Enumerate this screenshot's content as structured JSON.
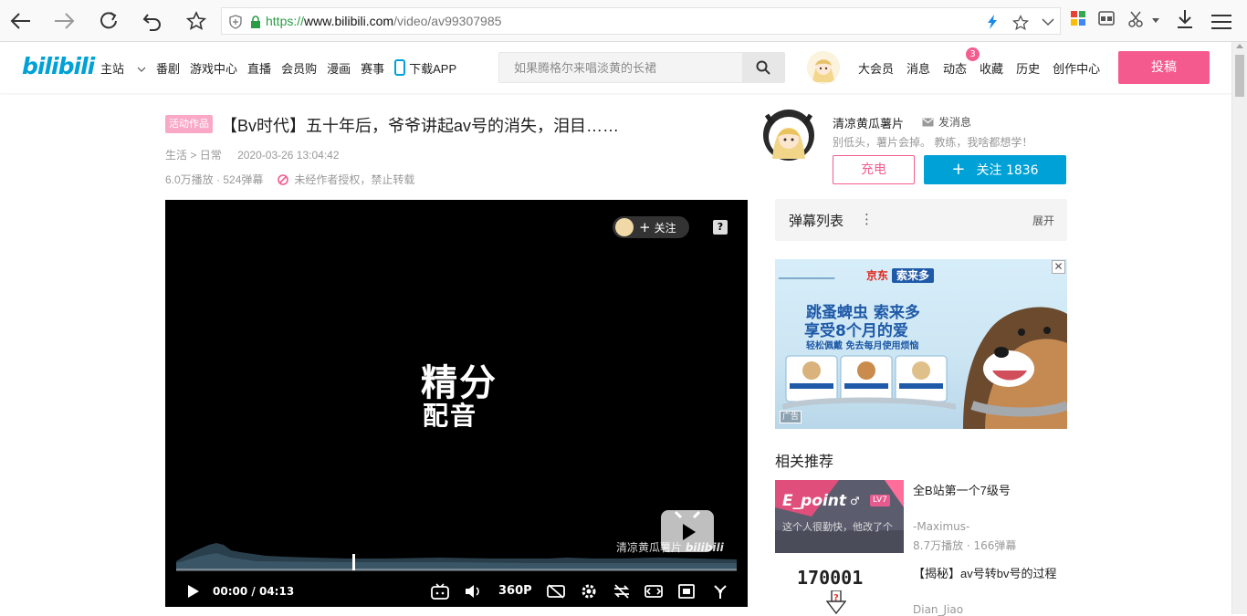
{
  "browser": {
    "url_scheme": "https://",
    "url_host": "www.bilibili.com",
    "url_path": "/video/av99307985"
  },
  "header": {
    "logo": "bilibili",
    "nav": [
      "主站",
      "番剧",
      "游戏中心",
      "直播",
      "会员购",
      "漫画",
      "赛事",
      "下载APP"
    ],
    "search_placeholder": "如果腾格尔来唱淡黄的长裙",
    "right_links": [
      "大会员",
      "消息",
      "动态",
      "收藏",
      "历史",
      "创作中心"
    ],
    "dynamic_badge": "3",
    "upload_label": "投稿"
  },
  "video": {
    "tag": "活动作品",
    "title": "【Bv时代】五十年后，爷爷讲起av号的消失，泪目……",
    "crumb_1": "生活",
    "crumb_sep": ">",
    "crumb_2": "日常",
    "date": "2020-03-26 13:04:42",
    "stats": "6.0万播放 · 524弹幕",
    "no_repost": "未经作者授权，禁止转载"
  },
  "player": {
    "follow_label": "关注",
    "help_icon": "?",
    "center_line1": "精分",
    "center_line2": "配音",
    "watermark": "清凉黄瓜薯片",
    "watermark_logo": "bilibili",
    "time_current": "00:00",
    "time_sep": "/",
    "time_total": "04:13",
    "quality": "360P"
  },
  "uploader": {
    "name": "清凉黄瓜薯片",
    "message_label": "发消息",
    "signature": "别低头，薯片会掉。 教练，我啥都想学！",
    "charge_label": "充电",
    "follow_label": "关注 1836"
  },
  "danmaku": {
    "title": "弹幕列表",
    "more_icon": "⋮",
    "expand_label": "展开"
  },
  "ad": {
    "brand_jd": "京东",
    "brand_product": "索来多",
    "headline1": "跳蚤蜱虫 索来多",
    "headline2": "享受8个月的爱",
    "headline3": "轻松佩戴 免去每月使用烦恼",
    "label": "广告",
    "close": "✕"
  },
  "recommend": {
    "title": "相关推荐",
    "items": [
      {
        "title": "全B站第一个7级号",
        "author": "-Maximus-",
        "stats": "8.7万播放 · 166弹幕",
        "thumb_heading": "E_point",
        "thumb_level": "LV7",
        "thumb_caption": "这个人很勤快，他改了个"
      },
      {
        "title": "【揭秘】av号转bv号的过程",
        "author": "Dian_Jiao",
        "thumb_number": "170001"
      }
    ]
  },
  "colors": {
    "accent_blue": "#00a1d6",
    "accent_pink": "#f45a8d"
  }
}
